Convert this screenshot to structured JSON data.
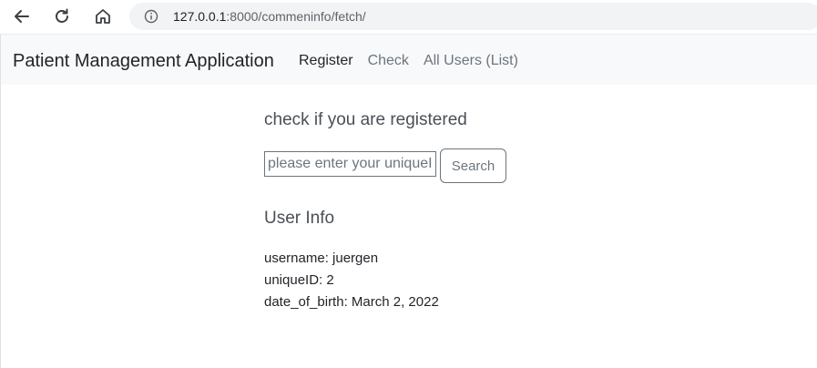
{
  "browser": {
    "url_host": "127.0.0.1",
    "url_rest": ":8000/commeninfo/fetch/",
    "icons": [
      "back-arrow-icon",
      "reload-icon",
      "home-icon",
      "info-icon"
    ]
  },
  "navbar": {
    "brand": "Patient Management Application",
    "links": [
      "Register",
      "Check",
      "All Users (List)"
    ]
  },
  "form": {
    "title": "check if you are registered",
    "input_placeholder": "please enter your uniqueID",
    "input_value": "",
    "search_label": "Search"
  },
  "user_info": {
    "title": "User Info",
    "username_line": "username: juergen",
    "uniqueid_line": "uniqueID: 2",
    "dob_line": "date_of_birth: March 2, 2022"
  },
  "colors": {
    "navbar_bg": "#f8f9fa",
    "active_link": "#212529",
    "inactive_link": "#6c757d"
  }
}
